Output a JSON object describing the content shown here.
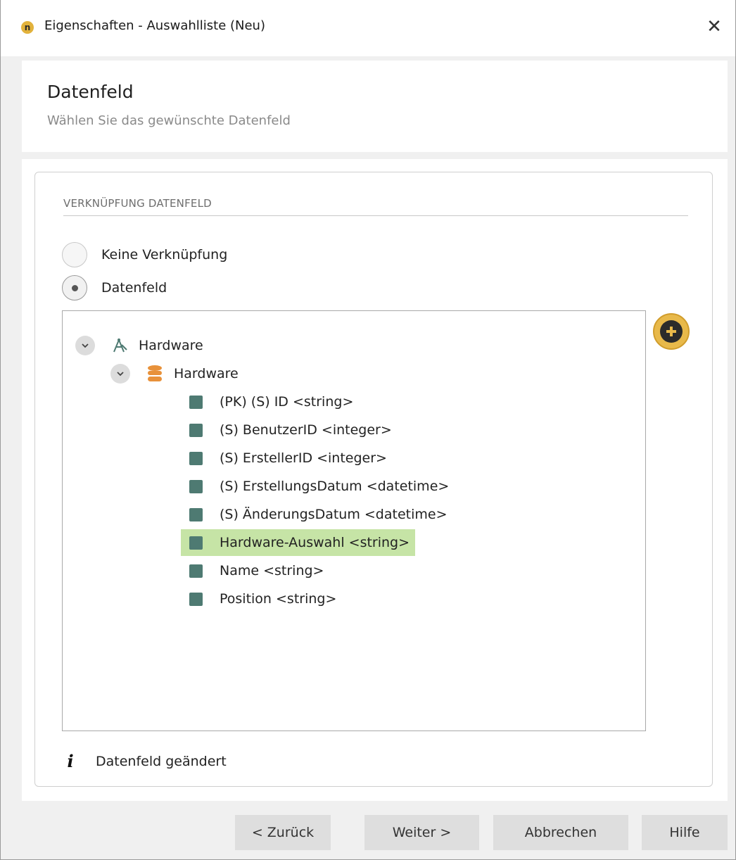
{
  "window": {
    "title": "Eigenschaften - Auswahlliste (Neu)",
    "app_icon_glyph": "n",
    "close_glyph": "✕"
  },
  "header": {
    "title": "Datenfeld",
    "subtitle": "Wählen Sie das gewünschte Datenfeld"
  },
  "section": {
    "label": "VERKNÜPFUNG DATENFELD"
  },
  "radios": [
    {
      "label": "Keine Verknüpfung",
      "checked": false
    },
    {
      "label": "Datenfeld",
      "checked": true
    }
  ],
  "tree": {
    "root": {
      "label": "Hardware",
      "icon": "diagram-icon",
      "expanded": true
    },
    "table": {
      "label": "Hardware",
      "icon": "database-icon",
      "expanded": true
    },
    "fields": [
      {
        "label": "(PK) (S) ID <string>",
        "selected": false
      },
      {
        "label": "(S) BenutzerID <integer>",
        "selected": false
      },
      {
        "label": "(S) ErstellerID <integer>",
        "selected": false
      },
      {
        "label": "(S) ErstellungsDatum <datetime>",
        "selected": false
      },
      {
        "label": "(S) ÄnderungsDatum <datetime>",
        "selected": false
      },
      {
        "label": "Hardware-Auswahl <string>",
        "selected": true
      },
      {
        "label": "Name <string>",
        "selected": false
      },
      {
        "label": "Position <string>",
        "selected": false
      }
    ]
  },
  "info": {
    "icon_glyph": "i",
    "text": "Datenfeld geändert"
  },
  "buttons": {
    "back": "< Zurück",
    "next": "Weiter >",
    "cancel": "Abbrechen",
    "help": "Hilfe"
  },
  "colors": {
    "accent": "#e8b94a",
    "field_square": "#4e7a72",
    "selected_row": "#c6e4a6",
    "db_icon": "#e8913a"
  }
}
